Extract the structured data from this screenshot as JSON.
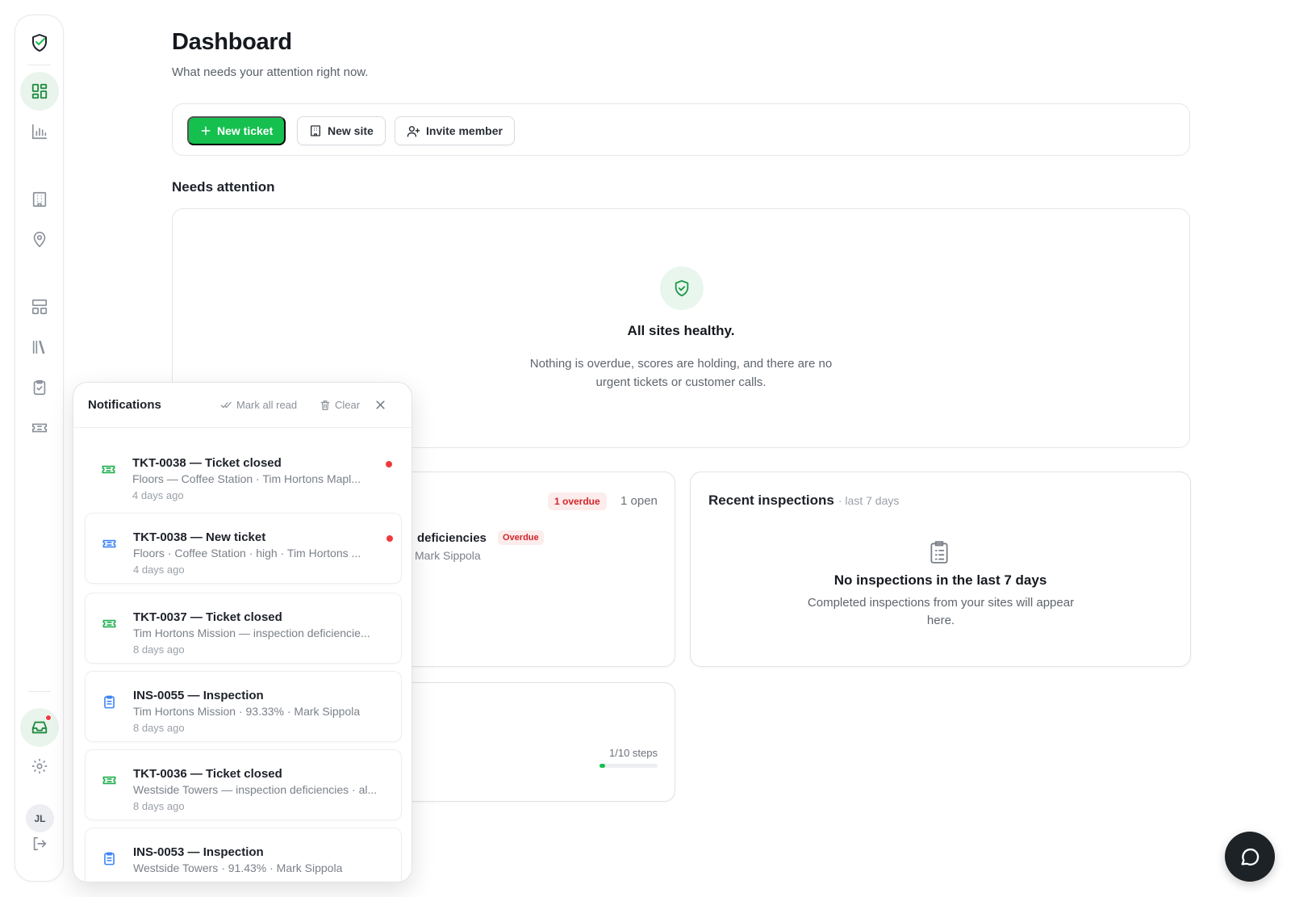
{
  "page": {
    "title": "Dashboard",
    "subtitle": "What needs your attention right now."
  },
  "actions": {
    "new_ticket": "New ticket",
    "new_site": "New site",
    "invite_member": "Invite member"
  },
  "attention": {
    "heading": "Needs attention",
    "empty_title": "All sites healthy.",
    "empty_desc": "Nothing is overdue, scores are holding, and there are no urgent tickets or customer calls."
  },
  "tickets_card": {
    "overdue_badge": "1 overdue",
    "open_count": "1 open",
    "row_title": "deficiencies",
    "row_badge": "Overdue",
    "row_sub": "Mark Sippola"
  },
  "onboarding_card": {
    "steps": "1/10 steps",
    "progress": 0.1
  },
  "inspections": {
    "title": "Recent inspections",
    "period": "· last 7 days",
    "empty_title": "No inspections in the last 7 days",
    "empty_desc": "Completed inspections from your sites will appear here."
  },
  "sidebar": {
    "avatar_initials": "JL",
    "inbox_has_unread": true
  },
  "notifications": {
    "title": "Notifications",
    "mark_all_read": "Mark all read",
    "clear": "Clear",
    "items": [
      {
        "title": "TKT-0038 — Ticket closed",
        "subtitle": "Floors — Coffee Station · Tim Hortons Mapl...",
        "time": "4 days ago",
        "icon": "ticket-icon",
        "color": "#1fae4e",
        "unread": true
      },
      {
        "title": "TKT-0038 — New ticket",
        "subtitle": "Floors · Coffee Station · high · Tim Hortons ...",
        "time": "4 days ago",
        "icon": "ticket-icon",
        "color": "#3b82f6",
        "unread": true
      },
      {
        "title": "TKT-0037 — Ticket closed",
        "subtitle": "Tim Hortons Mission — inspection deficiencie...",
        "time": "8 days ago",
        "icon": "ticket-icon",
        "color": "#1fae4e",
        "unread": false
      },
      {
        "title": "INS-0055 — Inspection",
        "subtitle": "Tim Hortons Mission · 93.33% · Mark Sippola",
        "time": "8 days ago",
        "icon": "clipboard-icon",
        "color": "#3b82f6",
        "unread": false
      },
      {
        "title": "TKT-0036 — Ticket closed",
        "subtitle": "Westside Towers — inspection deficiencies · al...",
        "time": "8 days ago",
        "icon": "ticket-icon",
        "color": "#1fae4e",
        "unread": false
      },
      {
        "title": "INS-0053 — Inspection",
        "subtitle": "Westside Towers · 91.43% · Mark Sippola",
        "time": "",
        "icon": "clipboard-icon",
        "color": "#3b82f6",
        "unread": false
      }
    ]
  },
  "colors": {
    "brand_green": "#15c04f",
    "alert_red": "#ef3b3b",
    "info_blue": "#3b82f6"
  }
}
